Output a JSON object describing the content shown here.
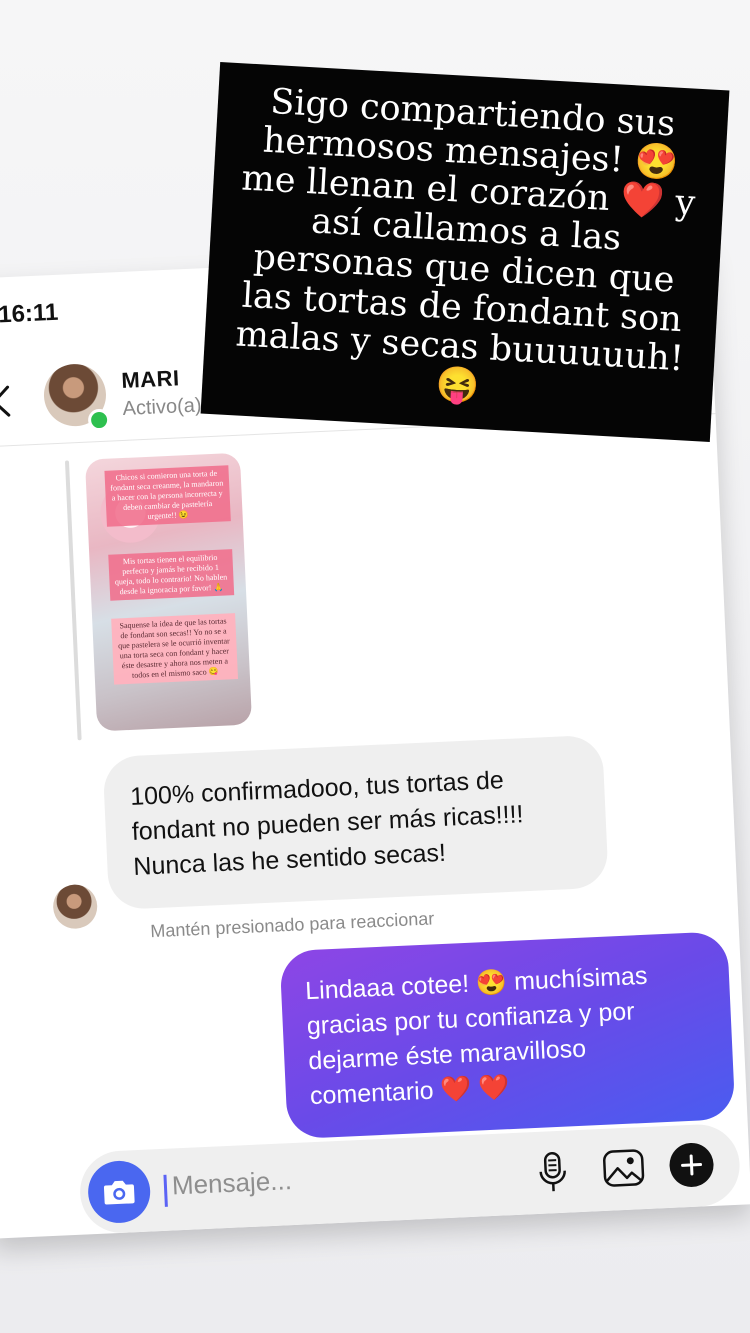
{
  "status_bar": {
    "time": "16:11"
  },
  "header": {
    "contact_name": "MARI",
    "contact_status": "Activo(a)"
  },
  "story": {
    "card1": "Chicos si comieron una torta de fondant seca creanme, la mandaron a hacer con la persona incorrecta y deben cambiar de pastelería urgente!! 😉",
    "card2": "Mis tortas tienen el equilibrio perfecto y jamás he recibido 1 queja, todo lo contrario! No hablen desde la ignoracia por favor! 🙏",
    "card3": "Saquense la idea de que las tortas de fondant son secas!! Yo no se a que pastelera se le ocurrió inventar una torta seca con fondant y hacer éste desastre y ahora nos meten a todos en el mismo saco 😋"
  },
  "messages": {
    "incoming_text": "100% confirmadooo, tus tortas de fondant no pueden ser más ricas!!!! Nunca las he sentido secas!",
    "hint": "Mantén presionado para reaccionar",
    "outgoing_text_a": "Lindaaa cotee! 😍  muchísimas gracias por tu confianza y por dejarme éste maravilloso comentario",
    "outgoing_hearts": "❤️ ❤️"
  },
  "composer": {
    "placeholder": "Mensaje..."
  },
  "overlay": {
    "caption": "Sigo compartiendo sus hermosos mensajes! 😍 me llenan el corazón ❤️ y así callamos a las personas que dicen que las tortas de fondant son malas y secas buuuuuuh! 😝"
  },
  "icons": {
    "back": "chevron-left-icon",
    "camera": "camera-icon",
    "mic": "microphone-icon",
    "gallery": "image-icon",
    "plus": "plus-icon"
  },
  "colors": {
    "outgoing_bubble_start": "#8d46e6",
    "outgoing_bubble_end": "#4a5cf0",
    "camera_button": "#4a67f0",
    "online_dot": "#2ec04f",
    "overlay_background": "#050505"
  }
}
